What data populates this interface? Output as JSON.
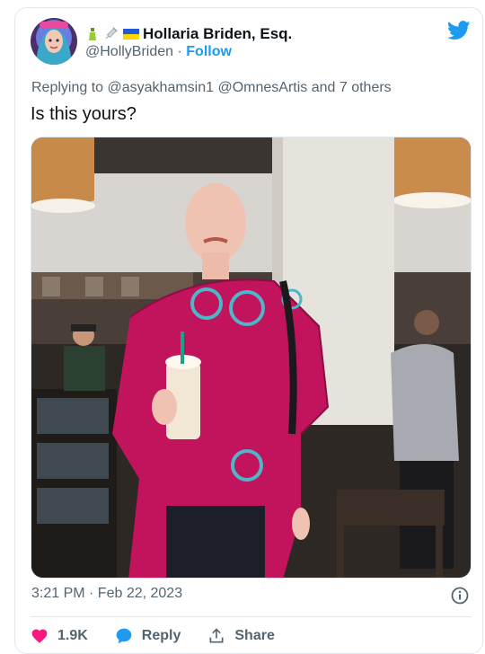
{
  "author": {
    "display_name": "Hollaria Briden, Esq.",
    "handle": "@HollyBriden",
    "separator": " · ",
    "follow_label": "Follow",
    "emoji_icons": [
      "bottle-icon",
      "syringe-icon",
      "ukraine-flag-icon"
    ]
  },
  "reply_context": {
    "prefix": "Replying to ",
    "user1": "@asyakhamsin1",
    "user2": "@OmnesArtis",
    "suffix": " and 7 others"
  },
  "tweet": {
    "text": "Is this yours?",
    "timestamp": "3:21 PM · Feb 22, 2023"
  },
  "actions": {
    "like_count": "1.9K",
    "reply_label": "Reply",
    "share_label": "Share"
  },
  "colors": {
    "twitter_blue": "#1d9bf0",
    "like_red": "#f91880",
    "text_secondary": "#536471"
  }
}
